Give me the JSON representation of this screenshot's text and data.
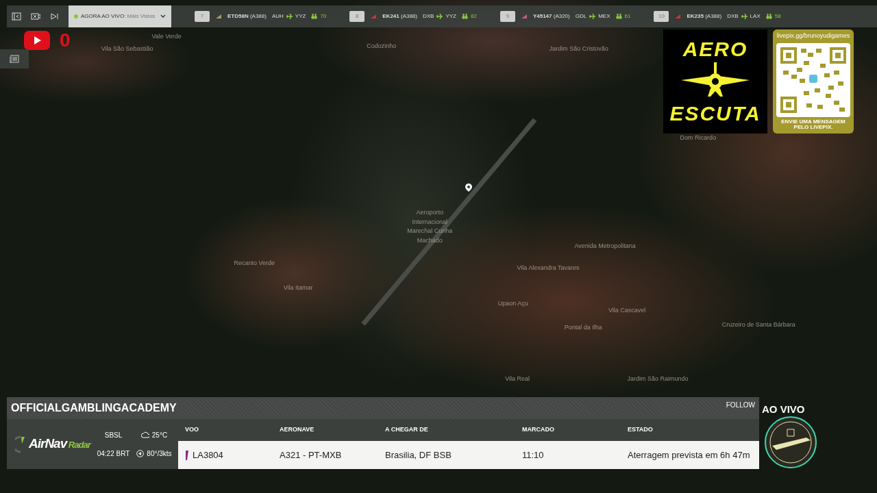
{
  "toolbar": {
    "live_label": "AGORA AO VIVO:",
    "live_filter": "Mais Vistos"
  },
  "ticker": [
    {
      "rank": "7",
      "flight": "ETD58N",
      "aircraft": "(A388)",
      "from": "AUH",
      "to": "YYZ",
      "viewers": "70",
      "color": "#a89a70"
    },
    {
      "rank": "8",
      "flight": "EK241",
      "aircraft": "(A388)",
      "from": "DXB",
      "to": "YYZ",
      "viewers": "82",
      "color": "#d0303c"
    },
    {
      "rank": "9",
      "flight": "Y45147",
      "aircraft": "(A320)",
      "from": "GDL",
      "to": "MEX",
      "viewers": "61",
      "color": "#c05a8a"
    },
    {
      "rank": "10",
      "flight": "EK235",
      "aircraft": "(A388)",
      "from": "DXB",
      "to": "LAX",
      "viewers": "58",
      "color": "#d0303c"
    }
  ],
  "youtube_counter": "0",
  "map_labels": [
    "Vila São Sebastião",
    "Vale Verde",
    "Codozinho",
    "Jardim São Cristovão",
    "Dom Ricardo",
    "Aeroporto Internacional Marechal Cunha Machado",
    "Recanto Verde",
    "Vila Itamar",
    "Vila Alexandra Tavares",
    "Vila Cascavel",
    "Upaon Açu",
    "Pontal da Ilha",
    "Cruzeiro de Santa Bárbara",
    "Vila Real",
    "Jardim São Raimundo",
    "Avenida Metropolitana"
  ],
  "aero_escuta": {
    "top": "AERO",
    "bottom": "ESCUTA"
  },
  "livepix": {
    "url": "livepix.gg/brunoyudigames",
    "message": "ENVIE UMA MENSAGEM PELO LIVEPIX."
  },
  "panel": {
    "channel": "OFFICIALGAMBLINGACADEMY",
    "follow": "FOLLOW",
    "logo": {
      "name": "AirNav",
      "suffix": "Radar"
    },
    "airport": "SBSL",
    "time": "04:22 BRT",
    "temperature": "25°C",
    "wind": "80°/3kts",
    "columns": [
      "VOO",
      "AERONAVE",
      "A CHEGAR DE",
      "MARCADO",
      "ESTADO"
    ],
    "row": [
      "LA3804",
      "A321 - PT-MXB",
      "Brasilia, DF BSB",
      "11:10",
      "Aterragem prevista em 6h 47m"
    ]
  },
  "live_badge": "AO VIVO"
}
